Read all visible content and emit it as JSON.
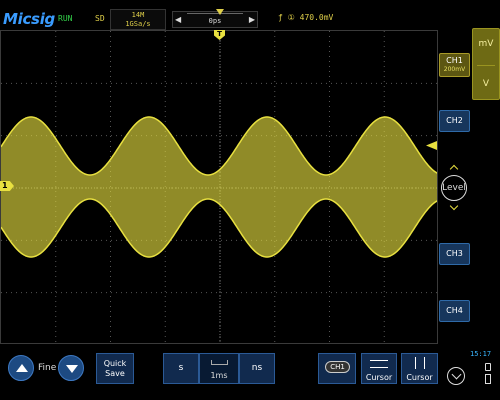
{
  "header": {
    "brand": "Micsig",
    "status": "RUN",
    "mode": "SD",
    "memory_depth": "14M",
    "sample_rate": "1GSa/s",
    "time_offset": "0ps",
    "trigger_info": "ƒ ① 470.0mV"
  },
  "right_panel": {
    "ch1_label": "CH1",
    "ch1_scale": "200mV",
    "ch2_label": "CH2",
    "ch3_label": "CH3",
    "ch4_label": "CH4",
    "level_label": "Level",
    "unit_label": "mV",
    "unit_sub": "V"
  },
  "markers": {
    "ch1_marker": "1",
    "trigger_marker": "T"
  },
  "bottom": {
    "fine_label": "Fine",
    "quick_save_line1": "Quick",
    "quick_save_line2": "Save",
    "timebase_coarse": "s",
    "timebase_value": "1ms",
    "timebase_fine": "ns",
    "ch1_pill": "CH1",
    "cursor1_label": "Cursor",
    "cursor2_label": "Cursor",
    "clock": "15:17"
  },
  "colors": {
    "ch1": "#e8e040",
    "accent_blue": "#2b5a96"
  }
}
